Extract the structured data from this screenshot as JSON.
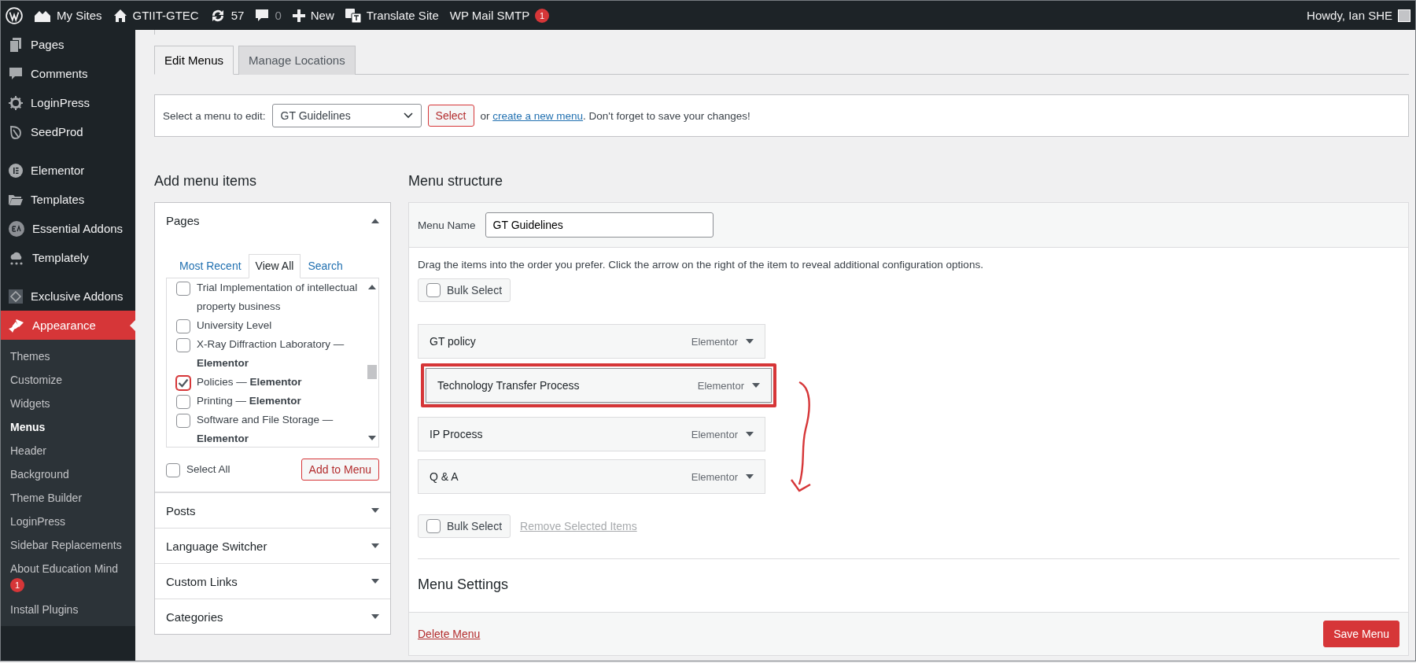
{
  "admin_bar": {
    "items": [
      {
        "kind": "wp-logo"
      },
      {
        "kind": "sites",
        "label": "My Sites"
      },
      {
        "kind": "home",
        "label": "GTIIT-GTEC"
      },
      {
        "kind": "updates",
        "label": "57"
      },
      {
        "kind": "comments",
        "label": "0"
      },
      {
        "kind": "new",
        "label": "New"
      },
      {
        "kind": "translate",
        "label": "Translate Site"
      },
      {
        "kind": "plain",
        "label": "WP Mail SMTP",
        "badge": "1"
      }
    ],
    "greeting": "Howdy, Ian SHE"
  },
  "sidebar": {
    "groups": [
      {
        "items": [
          {
            "label": "Pages",
            "selected": false
          },
          {
            "label": "Comments",
            "selected": false
          },
          {
            "label": "LoginPress",
            "selected": false
          },
          {
            "label": "SeedProd",
            "selected": false
          }
        ]
      },
      {
        "items": [
          {
            "label": "Elementor",
            "selected": false
          },
          {
            "label": "Templates",
            "selected": false
          },
          {
            "label": "Essential Addons",
            "selected": false
          },
          {
            "label": "Templately",
            "selected": false
          }
        ]
      },
      {
        "items": [
          {
            "label": "Exclusive Addons",
            "selected": false
          },
          {
            "label": "Appearance",
            "selected": true,
            "children": [
              {
                "label": "Themes",
                "selected": false
              },
              {
                "label": "Customize",
                "selected": false
              },
              {
                "label": "Widgets",
                "selected": false
              },
              {
                "label": "Menus",
                "selected": true
              },
              {
                "label": "Header",
                "selected": false
              },
              {
                "label": "Background",
                "selected": false
              },
              {
                "label": "Theme Builder",
                "selected": false
              },
              {
                "label": "LoginPress",
                "selected": false
              },
              {
                "label": "Sidebar Replacements",
                "selected": false
              },
              {
                "label": "About Education Mind",
                "selected": false,
                "badge": "1"
              },
              {
                "label": "Install Plugins",
                "selected": false
              }
            ]
          }
        ]
      }
    ]
  },
  "tabs": [
    {
      "label": "Edit Menus",
      "selected": true
    },
    {
      "label": "Manage Locations",
      "selected": false
    }
  ],
  "select_bar": {
    "label": "Select a menu to edit:",
    "dropdown": "GT Guidelines",
    "button": "Select",
    "text_before": "or",
    "link": "create a new menu",
    "text_after": ". Don't forget to save your changes!"
  },
  "add_menu_items": {
    "title": "Add menu items",
    "sections": [
      {
        "title": "Pages",
        "expanded": true,
        "tabs": [
          {
            "label": "Most Recent",
            "selected": false
          },
          {
            "label": "View All",
            "selected": true
          },
          {
            "label": "Search",
            "selected": false
          }
        ],
        "items": [
          {
            "label": "Trial Implementation of intellectual property business",
            "checked": false
          },
          {
            "label": "University Level",
            "checked": false
          },
          {
            "label": "X-Ray Diffraction Laboratory — **Elementor**",
            "checked": false
          },
          {
            "label": "Policies — **Elementor**",
            "checked": true
          },
          {
            "label": "Printing — **Elementor**",
            "checked": false
          },
          {
            "label": "Software and File Storage — **Elementor**",
            "checked": false
          }
        ],
        "select_all": {
          "label": "Select All",
          "checked": false
        },
        "button": "Add to Menu"
      },
      {
        "title": "Posts",
        "expanded": false
      },
      {
        "title": "Language Switcher",
        "expanded": false
      },
      {
        "title": "Custom Links",
        "expanded": false
      },
      {
        "title": "Categories",
        "expanded": false
      }
    ]
  },
  "menu_structure": {
    "title": "Menu structure",
    "name_label": "Menu Name",
    "name_value": "GT Guidelines",
    "instructions": "Drag the items into the order you prefer. Click the arrow on the right of the item to reveal additional configuration options.",
    "bulk_select_top": {
      "label": "Bulk Select",
      "checked": false
    },
    "items": [
      {
        "title": "GT policy",
        "type": "Elementor",
        "dragging": false
      },
      {
        "title": "Technology Transfer Process",
        "type": "Elementor",
        "dragging": true
      },
      {
        "title": "IP Process",
        "type": "Elementor",
        "dragging": false
      },
      {
        "title": "Q & A",
        "type": "Elementor",
        "dragging": false
      }
    ],
    "bulk_select_bottom": {
      "label": "Bulk Select",
      "checked": false
    },
    "remove_link": "Remove Selected Items",
    "settings_title": "Menu Settings",
    "delete_link": "Delete Menu",
    "save_button": "Save Menu"
  }
}
